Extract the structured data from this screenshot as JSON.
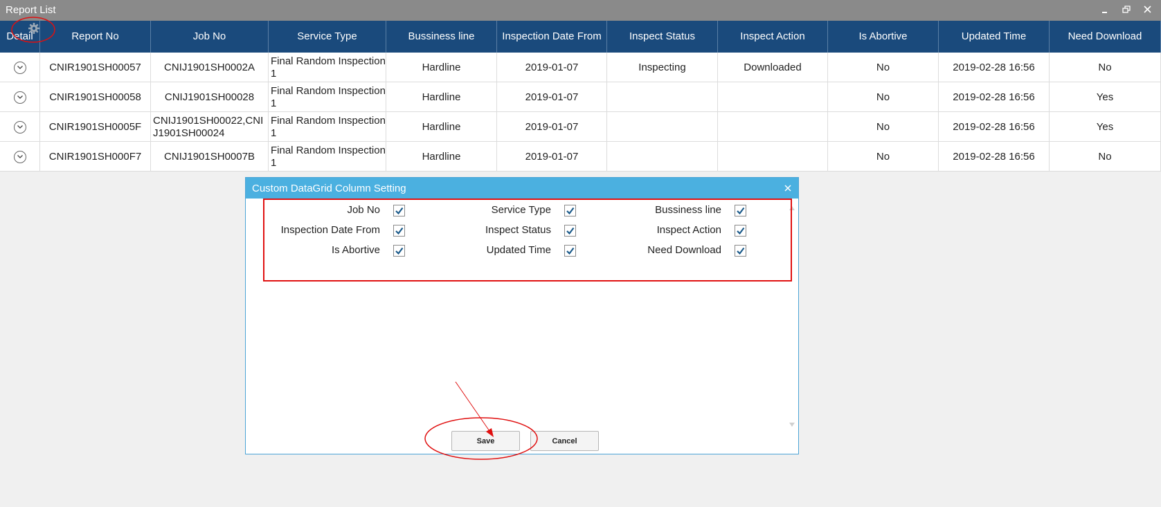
{
  "window": {
    "title": "Report List"
  },
  "grid": {
    "columns": [
      "Detail",
      "Report No",
      "Job No",
      "Service Type",
      "Bussiness line",
      "Inspection Date From",
      "Inspect Status",
      "Inspect Action",
      "Is Abortive",
      "Updated Time",
      "Need Download"
    ],
    "rows": [
      {
        "report_no": "CNIR1901SH00057",
        "job_no": "CNIJ1901SH0002A",
        "service_type": "Final Random Inspection 1",
        "business_line": "Hardline",
        "date_from": "2019-01-07",
        "inspect_status": "Inspecting",
        "inspect_action": "Downloaded",
        "is_abortive": "No",
        "updated_time": "2019-02-28 16:56",
        "need_download": "No"
      },
      {
        "report_no": "CNIR1901SH00058",
        "job_no": "CNIJ1901SH00028",
        "service_type": "Final Random Inspection 1",
        "business_line": "Hardline",
        "date_from": "2019-01-07",
        "inspect_status": "",
        "inspect_action": "",
        "is_abortive": "No",
        "updated_time": "2019-02-28 16:56",
        "need_download": "Yes"
      },
      {
        "report_no": "CNIR1901SH0005F",
        "job_no": "CNIJ1901SH00022,CNIJ1901SH00024",
        "service_type": "Final Random Inspection 1",
        "business_line": "Hardline",
        "date_from": "2019-01-07",
        "inspect_status": "",
        "inspect_action": "",
        "is_abortive": "No",
        "updated_time": "2019-02-28 16:56",
        "need_download": "Yes"
      },
      {
        "report_no": "CNIR1901SH000F7",
        "job_no": "CNIJ1901SH0007B",
        "service_type": "Final Random Inspection 1",
        "business_line": "Hardline",
        "date_from": "2019-01-07",
        "inspect_status": "",
        "inspect_action": "",
        "is_abortive": "No",
        "updated_time": "2019-02-28 16:56",
        "need_download": "No"
      }
    ]
  },
  "dialog": {
    "title": "Custom DataGrid Column Setting",
    "options": [
      {
        "label": "Job No",
        "checked": true
      },
      {
        "label": "Service Type",
        "checked": true
      },
      {
        "label": "Bussiness line",
        "checked": true
      },
      {
        "label": "Inspection Date From",
        "checked": true
      },
      {
        "label": "Inspect Status",
        "checked": true
      },
      {
        "label": "Inspect Action",
        "checked": true
      },
      {
        "label": "Is Abortive",
        "checked": true
      },
      {
        "label": "Updated Time",
        "checked": true
      },
      {
        "label": "Need Download",
        "checked": true
      }
    ],
    "save_label": "Save",
    "cancel_label": "Cancel"
  },
  "colors": {
    "header_bg": "#1a4a7c",
    "dialog_title_bg": "#4bb0e0",
    "check_color": "#1b5a8a",
    "annotation_red": "#e01010"
  },
  "icons": {
    "settings": "gear-icon",
    "expand": "chevron-down-icon",
    "close": "close-icon",
    "minimize": "minimize-icon",
    "restore": "restore-icon"
  }
}
